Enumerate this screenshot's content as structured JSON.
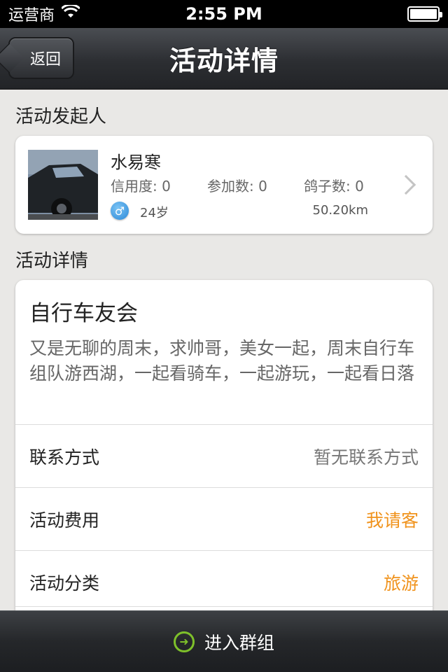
{
  "status_bar": {
    "carrier": "运营商",
    "time": "2:55 PM"
  },
  "nav": {
    "title": "活动详情",
    "back_label": "返回"
  },
  "organizer_section": {
    "title": "活动发起人",
    "name": "水易寒",
    "credit": "信用度: 0",
    "joined": "参加数: 0",
    "no_show": "鸽子数: 0",
    "gender": "male",
    "age": "24岁",
    "distance": "50.20km"
  },
  "detail_section": {
    "title": "活动详情",
    "activity_title": "自行车友会",
    "description": "又是无聊的周末，求帅哥，美女一起，周末自行车组队游西湖，一起看骑车，一起游玩，一起看日落",
    "rows": [
      {
        "label": "联系方式",
        "value": "暂无联系方式"
      },
      {
        "label": "活动费用",
        "value": "我请客"
      },
      {
        "label": "活动分类",
        "value": "旅游"
      }
    ]
  },
  "bottom_bar": {
    "action_label": "进入群组"
  },
  "colors": {
    "accent_orange": "#f0931d",
    "accent_green": "#7ec02a",
    "gender_blue": "#2a88d8"
  }
}
